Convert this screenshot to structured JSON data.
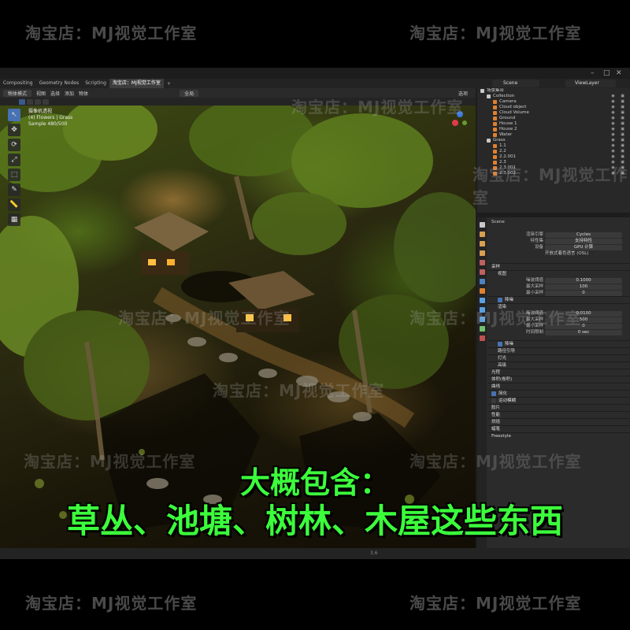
{
  "watermark": "淘宝店：MJ视觉工作室",
  "window_controls": {
    "minimize": "–",
    "maximize": "□",
    "close": "✕"
  },
  "workspace_tabs": [
    "Compositing",
    "Geometry Nodes",
    "Scripting",
    "淘宝店：MJ视觉工作室"
  ],
  "workspace_add": "+",
  "scene_selector": "Scene",
  "view_layer": "ViewLayer",
  "viewport_header": {
    "mode": "物体模式",
    "menus": [
      "视图",
      "选择",
      "添加",
      "物体"
    ],
    "transform": "全局",
    "options": "选项"
  },
  "viewport_overlay_text": {
    "line1": "摄像机透视",
    "line2": "(4) Flowers | Grass",
    "line3": "Sample 480/500"
  },
  "tools": [
    "↖",
    "✥",
    "⟳",
    "⤢",
    "⬚",
    "✎",
    "📏",
    "▦"
  ],
  "caption": {
    "line1": "大概包含：",
    "line2": "草丛、池塘、树林、木屋这些东西"
  },
  "outliner": {
    "root": "场景集合",
    "items": [
      {
        "label": "Collection",
        "color": "#c8c8c8",
        "indent": 1
      },
      {
        "label": "Camera",
        "color": "#e08030",
        "indent": 2
      },
      {
        "label": "Cloud object",
        "color": "#e08030",
        "indent": 2
      },
      {
        "label": "Cloud Volume",
        "color": "#e08030",
        "indent": 2
      },
      {
        "label": "Ground",
        "color": "#e08030",
        "indent": 2
      },
      {
        "label": "House 1",
        "color": "#e08030",
        "indent": 2
      },
      {
        "label": "House 2",
        "color": "#e08030",
        "indent": 2
      },
      {
        "label": "Water",
        "color": "#e08030",
        "indent": 2
      },
      {
        "label": "Grass",
        "color": "#c8c8c8",
        "indent": 1
      },
      {
        "label": "1.1",
        "color": "#e08030",
        "indent": 2
      },
      {
        "label": "2.2",
        "color": "#e08030",
        "indent": 2
      },
      {
        "label": "2.2.001",
        "color": "#e08030",
        "indent": 2
      },
      {
        "label": "2.3",
        "color": "#e08030",
        "indent": 2
      },
      {
        "label": "2.3.001",
        "color": "#e08030",
        "indent": 2
      },
      {
        "label": "2.3.002",
        "color": "#e08030",
        "indent": 2
      }
    ]
  },
  "properties": {
    "context": "Scene",
    "render_engine_label": "渲染引擎",
    "render_engine": "Cycles",
    "feature_set_label": "特性集",
    "feature_set": "支持特性",
    "device_label": "设备",
    "device": "GPU 计算",
    "osl_label": "开放式着色语言 (OSL)",
    "sampling": "采样",
    "viewport": "视图",
    "noise_threshold_label": "噪波阈值",
    "vp_noise_threshold": "0.1000",
    "max_samples_label": "最大采样",
    "vp_max_samples": "100",
    "min_samples_label": "最小采样",
    "vp_min_samples": "0",
    "denoise": "降噪",
    "render": "渲染",
    "r_noise_threshold": "0.0100",
    "r_max_samples": "500",
    "r_min_samples": "0",
    "time_limit_label": "时间限制",
    "r_time_limit": "0 sec",
    "denoise2": "降噪",
    "path_guiding": "路径引导",
    "lights": "灯光",
    "advanced": "高级",
    "light_paths": "光程",
    "volumes": "体积(卷积)",
    "curves": "曲线",
    "simplify": "简化",
    "motion_blur": "运动模糊",
    "film": "胶片",
    "performance": "性能",
    "bake": "烘焙",
    "grease_pencil": "蜡笔",
    "freestyle": "Freestyle"
  },
  "statusbar_text": "3.6"
}
